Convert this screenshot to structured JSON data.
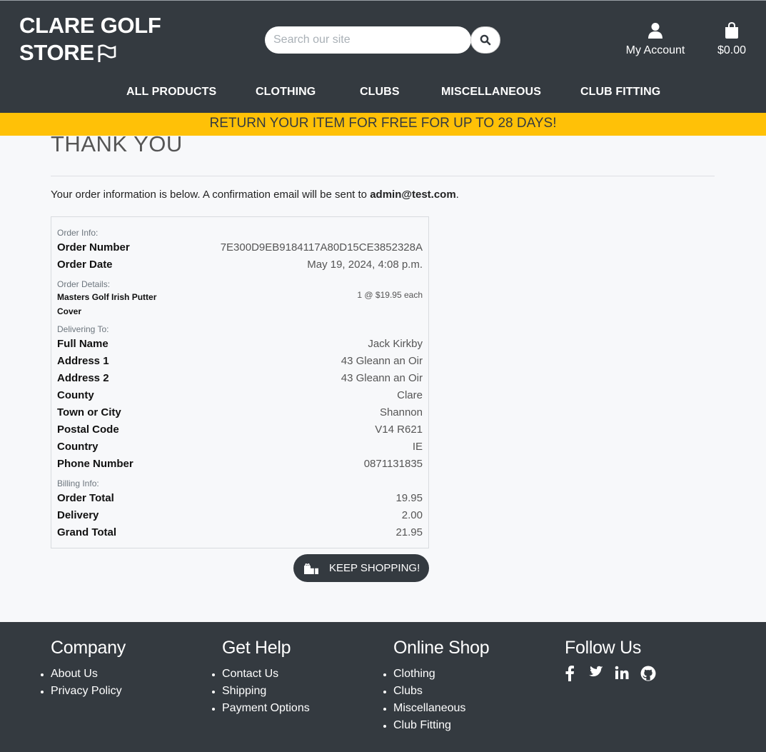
{
  "brand": {
    "line1": "CLARE GOLF",
    "line2": "STORE"
  },
  "search": {
    "placeholder": "Search our site",
    "value": ""
  },
  "header": {
    "account_label": "My Account",
    "cart_total": "$0.00"
  },
  "nav": [
    "ALL PRODUCTS",
    "CLOTHING",
    "CLUBS",
    "MISCELLANEOUS",
    "CLUB FITTING"
  ],
  "banner": "RETURN YOUR ITEM FOR FREE FOR UP TO 28 DAYS!",
  "main": {
    "title": "THANK YOU",
    "intro_text": "Your order information is below. A confirmation email will be sent to ",
    "email": "admin@test.com",
    "intro_end": "."
  },
  "order": {
    "order_info_label": "Order Info:",
    "order_number_label": "Order Number",
    "order_number": "7E300D9EB9184117A80D15CE3852328A",
    "order_date_label": "Order Date",
    "order_date": "May 19, 2024, 4:08 p.m.",
    "order_details_label": "Order Details:",
    "item_name": "Masters Golf Irish Putter Cover",
    "item_qty": "1 @ $19.95 each",
    "delivering_label": "Delivering To:",
    "full_name_label": "Full Name",
    "full_name": "Jack Kirkby",
    "address1_label": "Address 1",
    "address1": "43 Gleann an Oir",
    "address2_label": "Address 2",
    "address2": "43 Gleann an Oir",
    "county_label": "County",
    "county": "Clare",
    "town_label": "Town or City",
    "town": "Shannon",
    "postcode_label": "Postal Code",
    "postcode": "V14 R621",
    "country_label": "Country",
    "country": "IE",
    "phone_label": "Phone Number",
    "phone": "0871131835",
    "billing_label": "Billing Info:",
    "order_total_label": "Order Total",
    "order_total": "19.95",
    "delivery_label": "Delivery",
    "delivery": "2.00",
    "grand_total_label": "Grand Total",
    "grand_total": "21.95"
  },
  "keep_shopping": "KEEP SHOPPING!",
  "footer": {
    "company": {
      "heading": "Company",
      "links": [
        "About Us",
        "Privacy Policy"
      ]
    },
    "help": {
      "heading": "Get Help",
      "links": [
        "Contact Us",
        "Shipping",
        "Payment Options"
      ]
    },
    "shop": {
      "heading": "Online Shop",
      "links": [
        "Clothing",
        "Clubs",
        "Miscellaneous",
        "Club Fitting"
      ]
    },
    "follow": {
      "heading": "Follow Us",
      "icons": [
        "facebook-icon",
        "twitter-icon",
        "linkedin-icon",
        "github-icon"
      ]
    }
  },
  "colors": {
    "dark": "#343a40",
    "accent": "#ffc107",
    "background": "#f7f8fa"
  }
}
